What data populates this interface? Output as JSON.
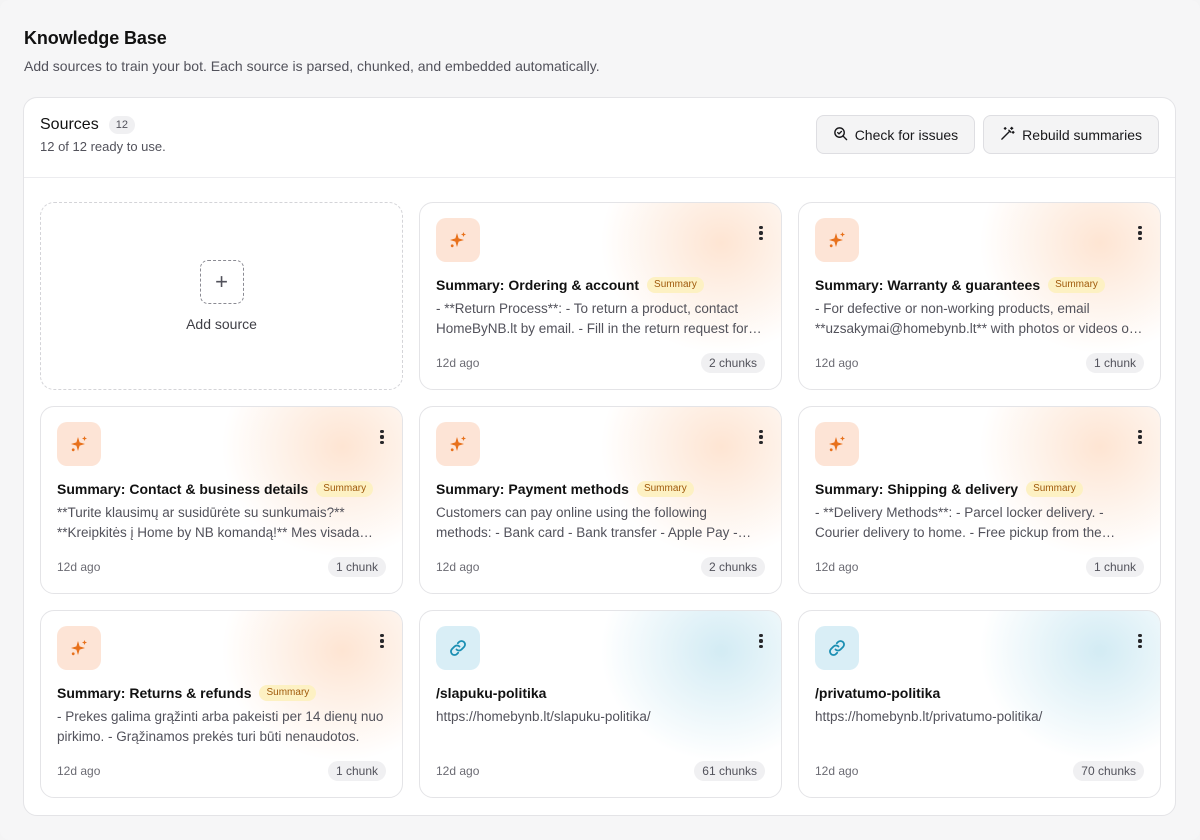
{
  "page": {
    "title": "Knowledge Base",
    "subtitle": "Add sources to train your bot. Each source is parsed, chunked, and embedded automatically."
  },
  "panel": {
    "title": "Sources",
    "count": "12",
    "status": "12 of 12 ready to use.",
    "actions": {
      "check_label": "Check for issues",
      "rebuild_label": "Rebuild summaries"
    }
  },
  "add_source": {
    "label": "Add source",
    "icon": "plus-icon"
  },
  "cards": [
    {
      "type": "summary",
      "title": "Summary: Ordering & account",
      "tag": "Summary",
      "description": "- **Return Process**: - To return a product, contact HomeByNB.lt by email. - Fill in the return request form and send it.",
      "date": "12d ago",
      "chunks": "2 chunks"
    },
    {
      "type": "summary",
      "title": "Summary: Warranty & guarantees",
      "tag": "Summary",
      "description": "- For defective or non-working products, email **uzsakymai@homebynb.lt** with photos or videos of the issue.",
      "date": "12d ago",
      "chunks": "1 chunk"
    },
    {
      "type": "summary",
      "title": "Summary: Contact & business details",
      "tag": "Summary",
      "description": "**Turite klausimų ar susidūrėte su sunkumais?** **Kreipkitės į Home by NB komandą!** Mes visada pasiruošę padėti.",
      "date": "12d ago",
      "chunks": "1 chunk"
    },
    {
      "type": "summary",
      "title": "Summary: Payment methods",
      "tag": "Summary",
      "description": "Customers can pay online using the following methods: - Bank card - Bank transfer - Apple Pay - Google Pay",
      "date": "12d ago",
      "chunks": "2 chunks"
    },
    {
      "type": "summary",
      "title": "Summary: Shipping & delivery",
      "tag": "Summary",
      "description": "- **Delivery Methods**: - Parcel locker delivery. - Courier delivery to home. - Free pickup from the showroom.",
      "date": "12d ago",
      "chunks": "1 chunk"
    },
    {
      "type": "summary",
      "title": "Summary: Returns & refunds",
      "tag": "Summary",
      "description": "- Prekes galima grąžinti arba pakeisti per 14 dienų nuo pirkimo. - Grąžinamos prekės turi būti nenaudotos.",
      "date": "12d ago",
      "chunks": "1 chunk"
    },
    {
      "type": "url",
      "title": "/slapuku-politika",
      "tag": "",
      "description": "https://homebynb.lt/slapuku-politika/",
      "date": "12d ago",
      "chunks": "61 chunks"
    },
    {
      "type": "url",
      "title": "/privatumo-politika",
      "tag": "",
      "description": "https://homebynb.lt/privatumo-politika/",
      "date": "12d ago",
      "chunks": "70 chunks"
    }
  ],
  "colors": {
    "summary_icon": "#e8711c",
    "url_icon": "#1b8fb3",
    "tag_bg": "#fdf1c3",
    "tag_text": "#a05a0c"
  }
}
